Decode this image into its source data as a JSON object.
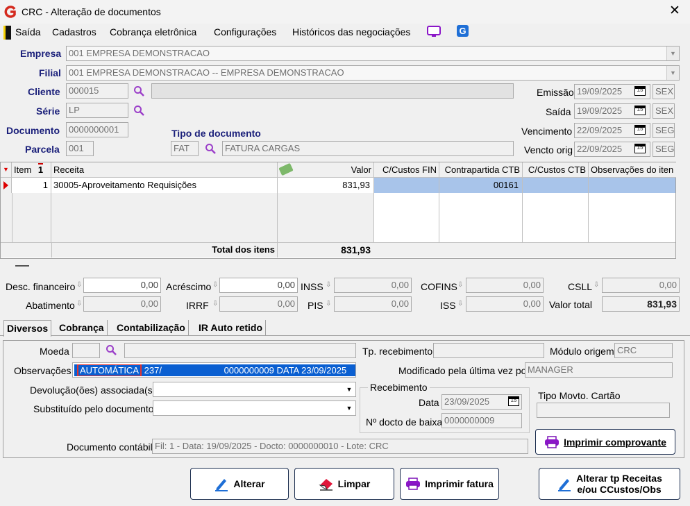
{
  "window": {
    "title": "CRC - Alteração de documentos",
    "close": "✕"
  },
  "menu": [
    "Saída",
    "Cadastros",
    "Cobrança eletrônica",
    "Configurações",
    "Históricos das negociações"
  ],
  "header": {
    "empresa_label": "Empresa",
    "empresa_value": "001 EMPRESA DEMONSTRACAO",
    "filial_label": "Filial",
    "filial_value": "001 EMPRESA DEMONSTRACAO -- EMPRESA DEMONSTRACAO",
    "cliente_label": "Cliente",
    "cliente_value": "000015",
    "serie_label": "Série",
    "serie_value": "LP",
    "documento_label": "Documento",
    "documento_value": "0000000001",
    "parcela_label": "Parcela",
    "parcela_value": "001",
    "tipo_label": "Tipo de documento",
    "tipo_code": "FAT",
    "tipo_desc": "FATURA CARGAS",
    "emissao_label": "Emissão",
    "emissao_date": "19/09/2025",
    "emissao_day": "SEX",
    "saida_label": "Saída",
    "saida_date": "19/09/2025",
    "saida_day": "SEX",
    "vencimento_label": "Vencimento",
    "vencimento_date": "22/09/2025",
    "vencimento_day": "SEG",
    "vencto_label": "Vencto orig",
    "vencto_date": "22/09/2025",
    "vencto_day": "SEG",
    "cal_icon": "calendar-icon",
    "cal_text": "15"
  },
  "grid": {
    "columns": [
      "Item",
      "Receita",
      "Valor",
      "C/Custos FIN",
      "Contrapartida CTB",
      "C/Custos CTB",
      "Observações do iten"
    ],
    "sort_marker": "1",
    "rows": [
      {
        "item": "1",
        "receita": "30005-Aproveitamento Requisições",
        "valor": "831,93",
        "cc_fin": "",
        "contrapartida": "00161",
        "cc_ctb": "",
        "obs": ""
      }
    ],
    "total_label": "Total dos itens",
    "total_value": "831,93"
  },
  "values": {
    "desc_label": "Desc. financeiro",
    "desc_value": "0,00",
    "acrescimo_label": "Acréscimo",
    "acrescimo_value": "0,00",
    "inss_label": "INSS",
    "inss_value": "0,00",
    "cofins_label": "COFINS",
    "cofins_value": "0,00",
    "csll_label": "CSLL",
    "csll_value": "0,00",
    "abatimento_label": "Abatimento",
    "abatimento_value": "0,00",
    "irrf_label": "IRRF",
    "irrf_value": "0,00",
    "pis_label": "PIS",
    "pis_value": "0,00",
    "iss_label": "ISS",
    "iss_value": "0,00",
    "total_label": "Valor total",
    "total_value": "831,93"
  },
  "tabs": [
    "Diversos",
    "Cobrança",
    "Contabilização",
    "IR Auto retido"
  ],
  "diversos": {
    "moeda_label": "Moeda",
    "obs_label": "Observações",
    "obs_highlight": "AUTOMÁTICA",
    "obs_rest1": "237/",
    "obs_rest2": "0000000009 DATA 23/09/2025",
    "devolucao_label": "Devolução(ões) associada(s)",
    "substituido_label": "Substituído pelo documento",
    "tp_receb_label": "Tp. recebimento",
    "modulo_label": "Módulo origem",
    "modulo_value": "CRC",
    "modificado_label": "Modificado pela última vez por",
    "modificado_value": "MANAGER",
    "recebimento_label": "Recebimento",
    "data_label": "Data",
    "data_value": "23/09/2025",
    "docto_baixa_label": "Nº docto de baixa",
    "docto_baixa_value": "0000000009",
    "tipo_cartao_label": "Tipo Movto. Cartão",
    "imprimir_comprovante": "Imprimir comprovante",
    "doc_contabil_label": "Documento contábil",
    "doc_contabil_value": "Fil: 1 - Data: 19/09/2025 - Docto: 0000000010 - Lote: CRC"
  },
  "buttons": {
    "alterar": "Alterar",
    "limpar": "Limpar",
    "imprimir_fatura": "Imprimir fatura",
    "alterar_tp_1": "Alterar tp Receitas",
    "alterar_tp_2": "e/ou CCustos/Obs"
  },
  "colors": {
    "accent": "#1a1f7a",
    "selection": "#0a5fd1",
    "row_selected": "#a8c4ea",
    "logo_red": "#d42a1e",
    "purple_icon": "#8b16c8"
  }
}
